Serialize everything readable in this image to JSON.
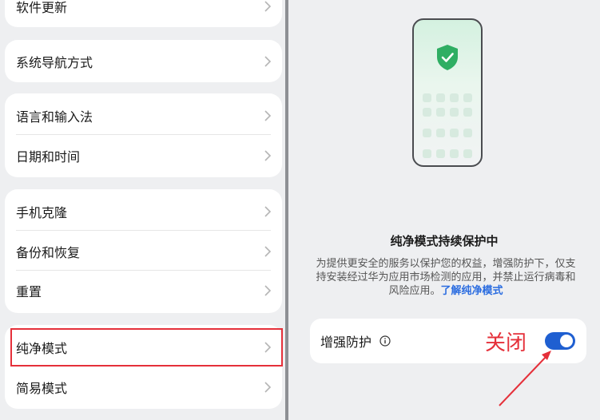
{
  "left_menu": {
    "groups": [
      {
        "items": [
          {
            "label": "软件更新"
          }
        ]
      },
      {
        "items": [
          {
            "label": "系统导航方式"
          }
        ]
      },
      {
        "items": [
          {
            "label": "语言和输入法"
          },
          {
            "label": "日期和时间"
          }
        ]
      },
      {
        "items": [
          {
            "label": "手机克隆"
          },
          {
            "label": "备份和恢复"
          },
          {
            "label": "重置"
          }
        ]
      },
      {
        "items": [
          {
            "label": "纯净模式"
          },
          {
            "label": "简易模式"
          }
        ]
      }
    ],
    "chevron_icon": "chevron-right-icon",
    "highlight_color": "#e5303a"
  },
  "pure_mode": {
    "illustration_icon": "shield-check-icon",
    "title": "纯净模式持续保护中",
    "description": "为提供更安全的服务以保护您的权益，增强防护下，仅支持安装经过华为应用市场检测的应用，并禁止运行病毒和风险应用。",
    "link": "了解纯净模式",
    "enhanced_protection": {
      "label": "增强防护",
      "info_icon": "info-icon",
      "switch_on": true,
      "switch_color": "#1f5fd1"
    },
    "annotation": "关闭",
    "annotation_color": "#e5303a"
  }
}
